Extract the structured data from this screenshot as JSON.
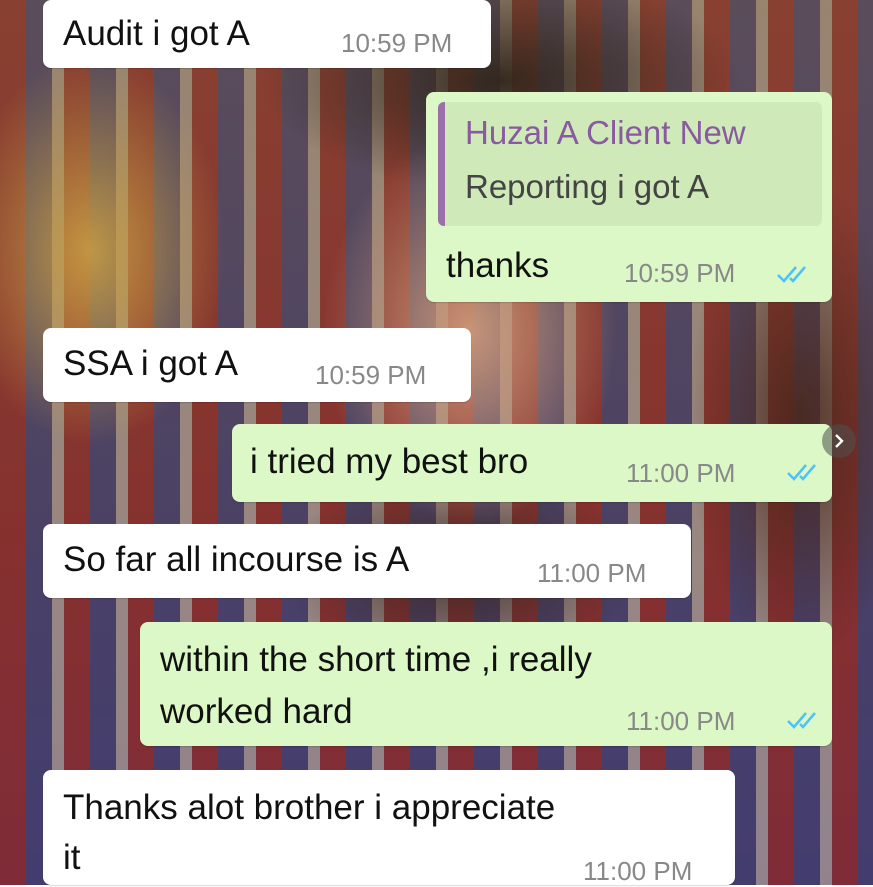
{
  "messages": [
    {
      "text": "Audit i got A",
      "time": "10:59 PM"
    },
    {
      "quote_name": "Huzai A Client New",
      "quote_text": "Reporting i got A",
      "text": "thanks",
      "time": "10:59 PM"
    },
    {
      "text": "SSA i got A",
      "time": "10:59 PM"
    },
    {
      "text": "i tried my best bro",
      "time": "11:00 PM"
    },
    {
      "text": "So far all incourse is A",
      "time": "11:00 PM"
    },
    {
      "line1": "within the short time ,i really",
      "line2": "worked hard",
      "time": "11:00 PM"
    },
    {
      "line1": "Thanks alot brother i appreciate",
      "line2": "it",
      "time": "11:00 PM"
    }
  ],
  "icons": {
    "read_receipt": "double-check-icon",
    "forward": "chevron-right-icon"
  },
  "colors": {
    "incoming_bubble": "#ffffff",
    "outgoing_bubble": "#dcf8c6",
    "read_tick": "#4fc3f7",
    "quote_accent": "#9b6fa8"
  }
}
